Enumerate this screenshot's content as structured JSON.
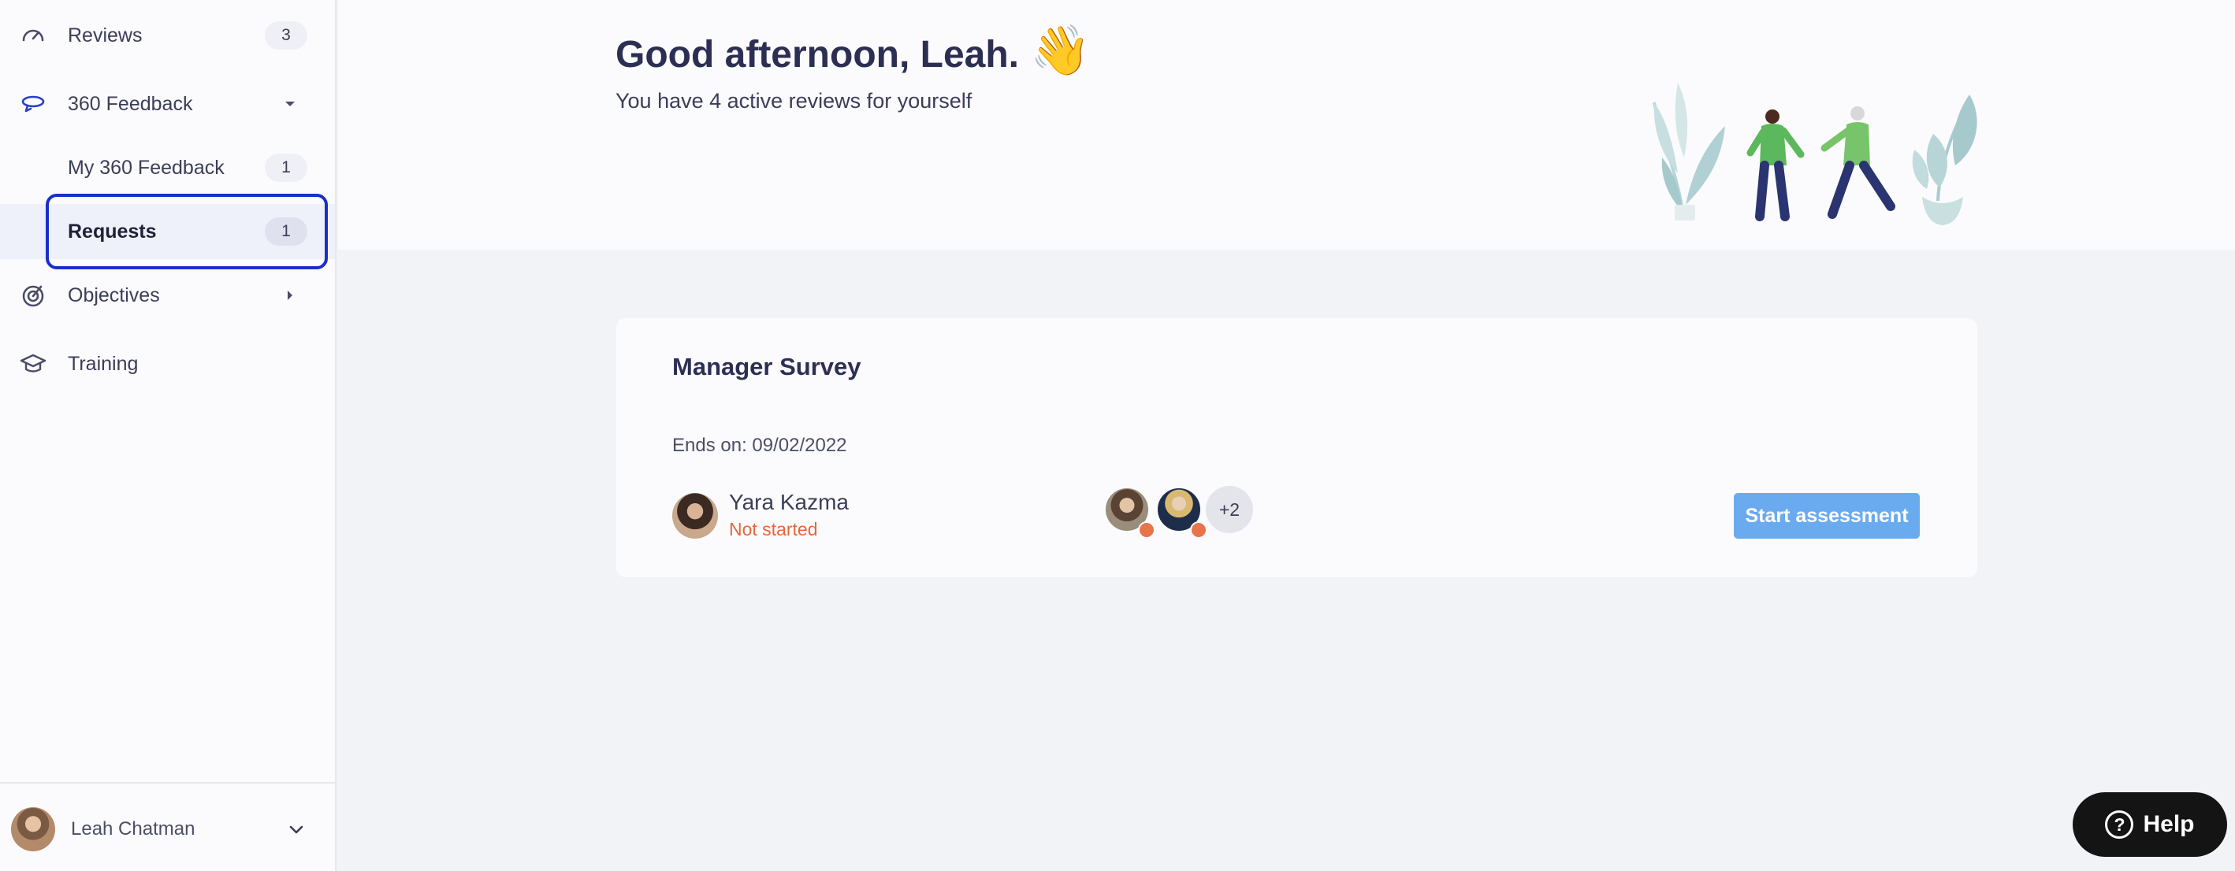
{
  "sidebar": {
    "items": [
      {
        "label": "Reviews",
        "count": "3",
        "icon": "speedometer-icon"
      },
      {
        "label": "360 Feedback",
        "icon": "feedback-loop-icon"
      },
      {
        "label": "My 360 Feedback",
        "count": "1"
      },
      {
        "label": "Requests",
        "count": "1"
      },
      {
        "label": "Objectives",
        "icon": "target-icon"
      },
      {
        "label": "Training",
        "icon": "graduation-cap-icon"
      }
    ],
    "user": {
      "name": "Leah Chatman"
    }
  },
  "header": {
    "greeting": "Good afternoon, Leah.",
    "wave": "👋",
    "subtitle": "You have 4 active reviews for yourself"
  },
  "card": {
    "title": "Manager Survey",
    "ends": "Ends on: 09/02/2022",
    "reviewee": {
      "name": "Yara Kazma",
      "status": "Not started"
    },
    "more_reviewers": "+2",
    "button": "Start assessment"
  },
  "help": {
    "label": "Help",
    "icon_glyph": "?"
  },
  "colors": {
    "accent": "#1a2fc8",
    "button": "#6aabf0",
    "status_not_started": "#e4683a"
  }
}
